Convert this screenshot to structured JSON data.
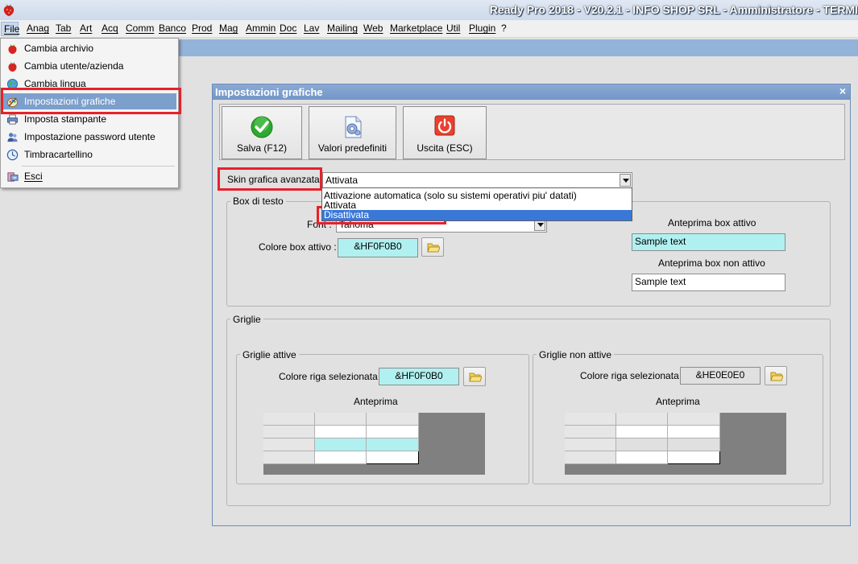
{
  "window": {
    "title": "Ready Pro 2018 - V20.2.1 - INFO SHOP SRL - Amministratore - TERMI"
  },
  "menubar": {
    "items": [
      "File",
      "Anag",
      "Tab",
      "Art",
      "Acq",
      "Comm",
      "Banco",
      "Prod",
      "Mag",
      "Ammin",
      "Doc",
      "Lav",
      "Mailing",
      "Web",
      "Marketplace",
      "Util",
      "Plugin",
      "?"
    ]
  },
  "file_menu": {
    "items": [
      {
        "label": "Cambia archivio",
        "icon": "strawberry-icon"
      },
      {
        "label": "Cambia utente/azienda",
        "icon": "strawberry-icon"
      },
      {
        "label": "Cambia lingua",
        "icon": "globe-icon"
      },
      {
        "label": "Impostazioni grafiche",
        "icon": "palette-icon",
        "selected": true
      },
      {
        "label": "Imposta stampante",
        "icon": "printer-icon"
      },
      {
        "label": "Impostazione password utente",
        "icon": "users-icon"
      },
      {
        "label": "Timbracartellino",
        "icon": "clock-icon"
      },
      {
        "label": "Esci",
        "icon": "exit-icon"
      }
    ]
  },
  "dialog": {
    "title": "Impostazioni grafiche",
    "close": "×",
    "toolbar": {
      "save_label": "Salva (F12)",
      "defaults_label": "Valori predefiniti",
      "exit_label": "Uscita (ESC)"
    },
    "skin": {
      "label": "Skin grafica avanzata :",
      "value": "Attivata",
      "options": [
        "Attivazione automatica (solo su sistemi operativi piu' datati)",
        "Attivata",
        "Disattivata"
      ],
      "highlighted_option": "Disattivata"
    },
    "text_box": {
      "title": "Box di testo",
      "font_label": "Font :",
      "font_value": "Tahoma",
      "active_color_label": "Colore box attivo :",
      "active_color_value": "&HF0F0B0",
      "preview_active_label": "Anteprima box attivo",
      "preview_active_text": "Sample text",
      "preview_inactive_label": "Anteprima box non attivo",
      "preview_inactive_text": "Sample text"
    },
    "grids": {
      "title": "Griglie",
      "active": {
        "title": "Griglie attive",
        "row_color_label": "Colore riga selezionata :",
        "row_color_value": "&HF0F0B0",
        "preview_label": "Anteprima"
      },
      "inactive": {
        "title": "Griglie non attive",
        "row_color_label": "Colore riga selezionata :",
        "row_color_value": "&HE0E0E0",
        "preview_label": "Anteprima"
      }
    }
  },
  "colors": {
    "active_tint": "#b0f0f0",
    "inactive_tint": "#e0e0e0",
    "highlight": "#e8202a",
    "selection": "#3a78d8"
  }
}
